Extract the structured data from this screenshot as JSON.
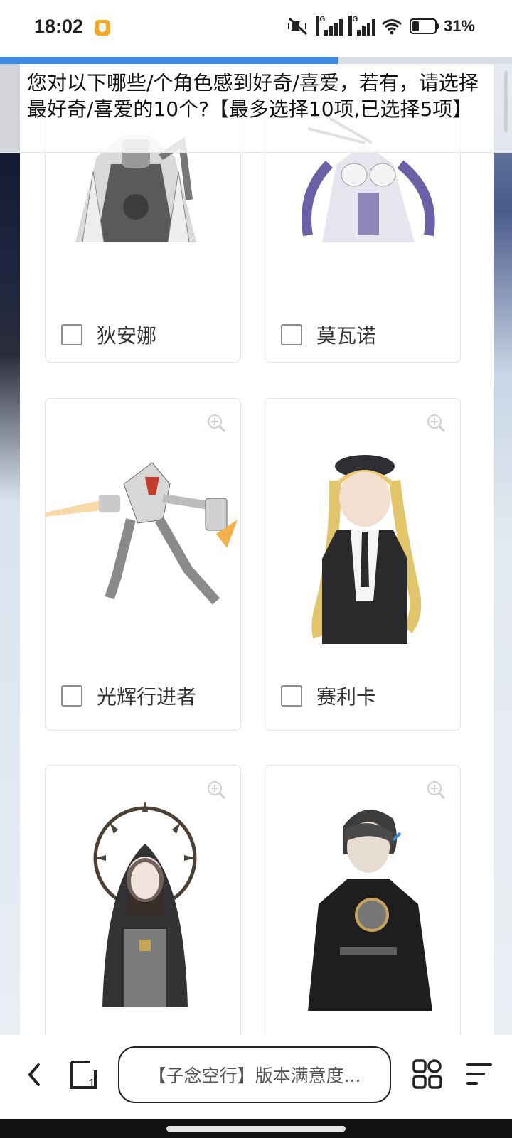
{
  "status_bar": {
    "time": "18:02",
    "network_1": "5G",
    "network_2": "5G",
    "battery_text": "31%",
    "battery_level": 0.31
  },
  "progress": {
    "fraction": 0.66,
    "color": "#3b8ae8"
  },
  "question": {
    "text": "您对以下哪些/个角色感到好奇/喜爱，若有，请选择最好奇/喜爱的10个?【最多选择10项,已选择5项】"
  },
  "options": [
    {
      "label": "狄安娜",
      "checked": false
    },
    {
      "label": "莫瓦诺",
      "checked": false
    },
    {
      "label": "光辉行进者",
      "checked": false
    },
    {
      "label": "赛利卡",
      "checked": false
    },
    {
      "label": "",
      "checked": false
    },
    {
      "label": "",
      "checked": false
    }
  ],
  "icons": {
    "zoom": "zoom-in-icon",
    "back": "chevron-left-icon",
    "tabs": "tabs-icon",
    "apps": "apps-grid-icon",
    "menu": "menu-icon"
  },
  "toolbar": {
    "address_text": "【子念空行】版本满意度..."
  }
}
